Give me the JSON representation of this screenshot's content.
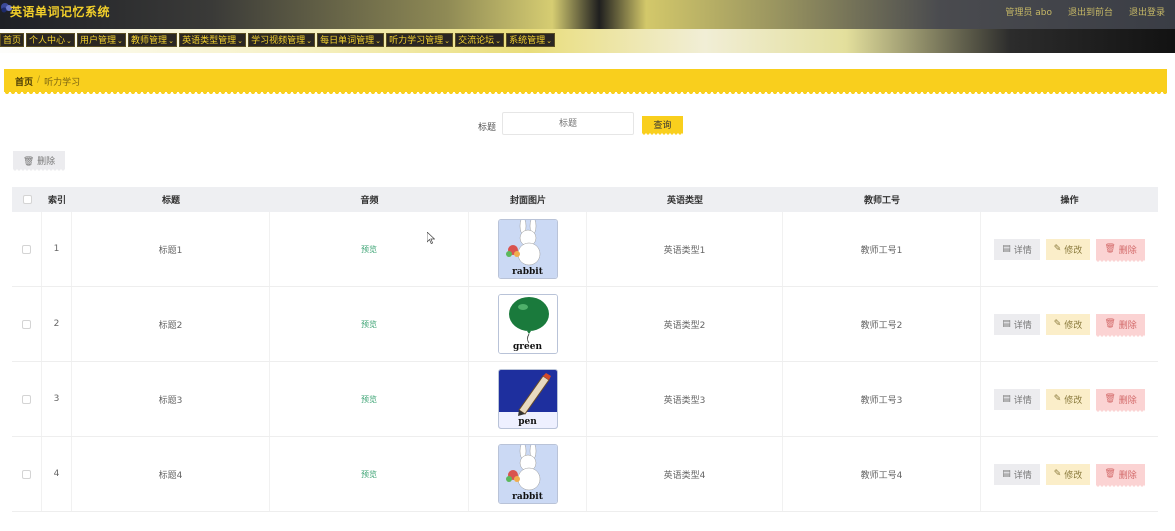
{
  "header": {
    "app_title": "英语单词记忆系统",
    "user_label": "管理员 abo",
    "logout_label": "退出到前台",
    "exit_label": "退出登录"
  },
  "nav": {
    "items": [
      {
        "label": "首页",
        "caret": false
      },
      {
        "label": "个人中心",
        "caret": true
      },
      {
        "label": "用户管理",
        "caret": true
      },
      {
        "label": "教师管理",
        "caret": true
      },
      {
        "label": "英语类型管理",
        "caret": true
      },
      {
        "label": "学习视频管理",
        "caret": true
      },
      {
        "label": "每日单词管理",
        "caret": true
      },
      {
        "label": "听力学习管理",
        "caret": true
      },
      {
        "label": "交流论坛",
        "caret": true
      },
      {
        "label": "系统管理",
        "caret": true
      }
    ]
  },
  "breadcrumb": {
    "home": "首页",
    "separator": "/",
    "current": "听力学习"
  },
  "search": {
    "label": "标题",
    "placeholder": "标题",
    "button_label": "查询"
  },
  "toolbar": {
    "delete_label": "删除"
  },
  "table": {
    "columns": [
      "索引",
      "标题",
      "音频",
      "封面图片",
      "英语类型",
      "教师工号",
      "操作"
    ],
    "rows": [
      {
        "index": "1",
        "title": "标题1",
        "audio": "预览",
        "cover": "rabbit",
        "type": "英语类型1",
        "teacher_id": "教师工号1"
      },
      {
        "index": "2",
        "title": "标题2",
        "audio": "预览",
        "cover": "green",
        "type": "英语类型2",
        "teacher_id": "教师工号2"
      },
      {
        "index": "3",
        "title": "标题3",
        "audio": "预览",
        "cover": "pen",
        "type": "英语类型3",
        "teacher_id": "教师工号3"
      },
      {
        "index": "4",
        "title": "标题4",
        "audio": "预览",
        "cover": "rabbit",
        "type": "英语类型4",
        "teacher_id": "教师工号4"
      }
    ],
    "actions": {
      "detail": "详情",
      "edit": "修改",
      "delete": "删除"
    }
  },
  "colors": {
    "accent": "#f9cf1d",
    "nav_text": "#f4d22f",
    "audio_link": "#3ba373"
  },
  "icons": {
    "detail": "document-icon",
    "edit": "pencil-icon",
    "delete": "trash-icon"
  }
}
